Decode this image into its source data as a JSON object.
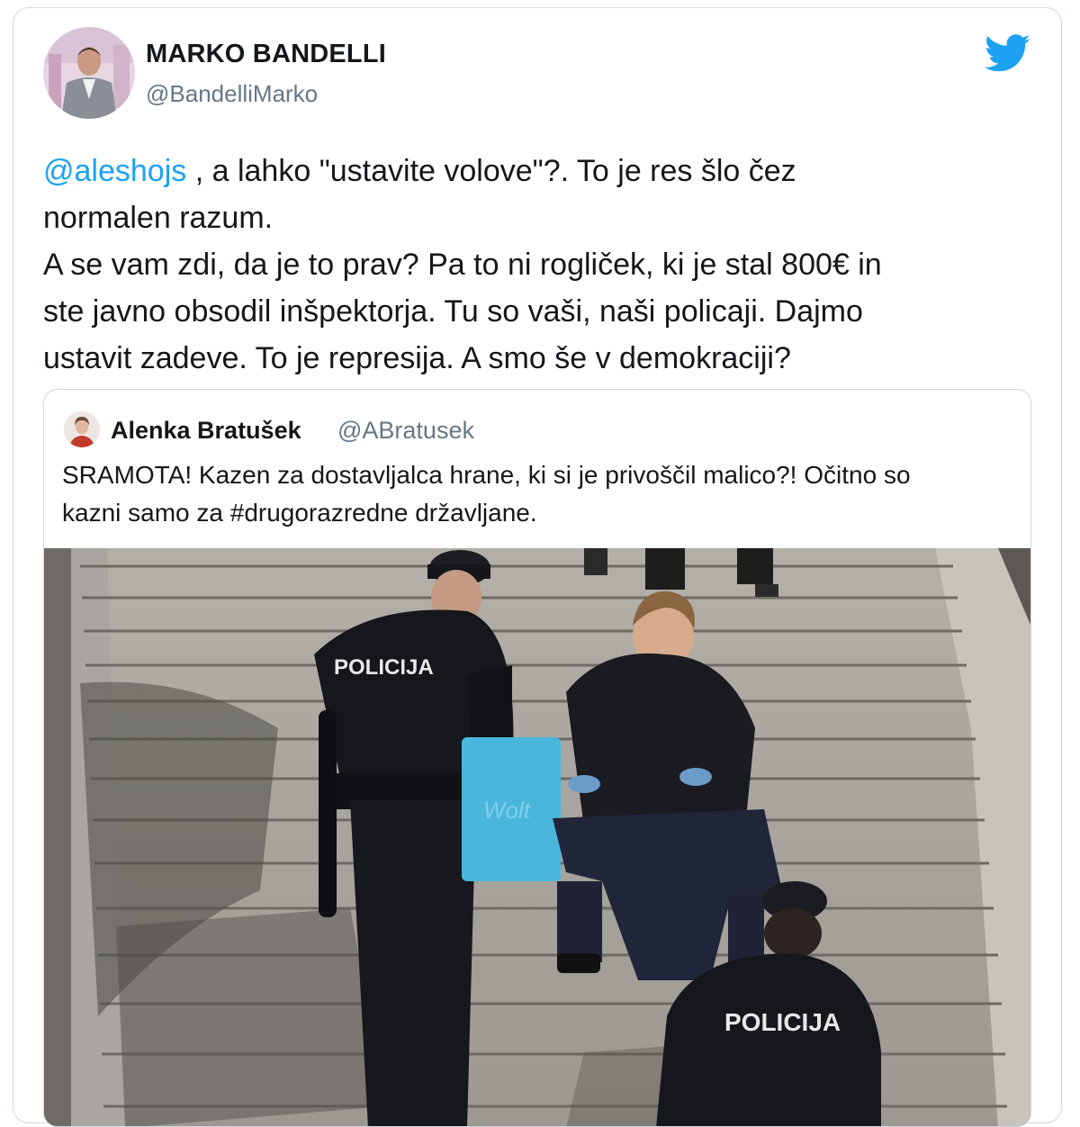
{
  "tweet": {
    "author_name": "MARKO BANDELLI",
    "author_handle": "@BandelliMarko",
    "mention": "@aleshojs",
    "lines": [
      " , a lahko \"ustavite volove\"?. To je res šlo čez",
      "normalen razum.",
      "A se vam zdi, da je to prav? Pa to ni rogliček, ki je stal 800€ in",
      "ste javno obsodil inšpektorja. Tu so vaši, naši policaji. Dajmo",
      "ustavit zadeve. To je represija. A smo še v demokraciji?"
    ],
    "brand_icon": "twitter-bird-icon",
    "brand_color": "#1da1f2"
  },
  "quoted": {
    "author_name": "Alenka Bratušek",
    "author_handle": "@ABratusek",
    "lines": [
      "SRAMOTA! Kazen za dostavljalca hrane, ki si je privoščil malico?! Očitno so",
      "kazni samo za #drugorazredne državljane."
    ],
    "photo": {
      "badge_left": "POLICIJA",
      "badge_right": "POLICIJA",
      "bag_logo": "Wolt"
    }
  }
}
